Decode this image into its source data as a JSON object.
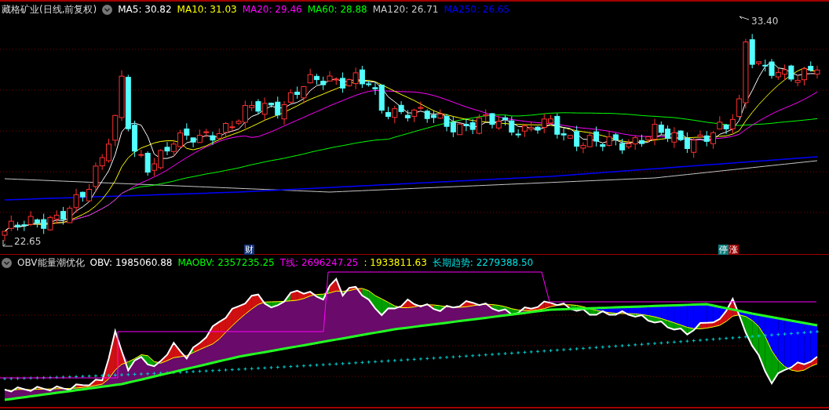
{
  "price_panel": {
    "title": "藏格矿业(日线,前复权)",
    "indicators": [
      {
        "label": "MA5: 30.82",
        "color": "#ffffff"
      },
      {
        "label": "MA10: 31.03",
        "color": "#ffff00"
      },
      {
        "label": "MA20: 29.46",
        "color": "#ff00ff"
      },
      {
        "label": "MA60: 28.88",
        "color": "#00ff00"
      },
      {
        "label": "MA120: 26.71",
        "color": "#c8c8c8"
      },
      {
        "label": "MA250: 26.65",
        "color": "#0000ff"
      }
    ],
    "high_label": "33.40",
    "low_label": "22.65",
    "event_tags": [
      {
        "segments": [
          {
            "text": "财",
            "color": "#16357a"
          }
        ]
      },
      {
        "segments": [
          {
            "text": "停",
            "color": "#0e8080"
          },
          {
            "text": "涨",
            "color": "#a00000"
          }
        ]
      }
    ]
  },
  "obv_panel": {
    "title": "OBV能量潮优化",
    "indicators": [
      {
        "label": "OBV: 1985060.88",
        "color": "#ffffff"
      },
      {
        "label": "MAOBV: 2357235.25",
        "color": "#00ff00"
      },
      {
        "label": "T线: 2696247.25",
        "color": "#ff00ff"
      },
      {
        "label": ": 1933811.63",
        "color": "#ffff00"
      },
      {
        "label": "长期趋势: 2279388.50",
        "color": "#00e0e0"
      }
    ]
  }
}
